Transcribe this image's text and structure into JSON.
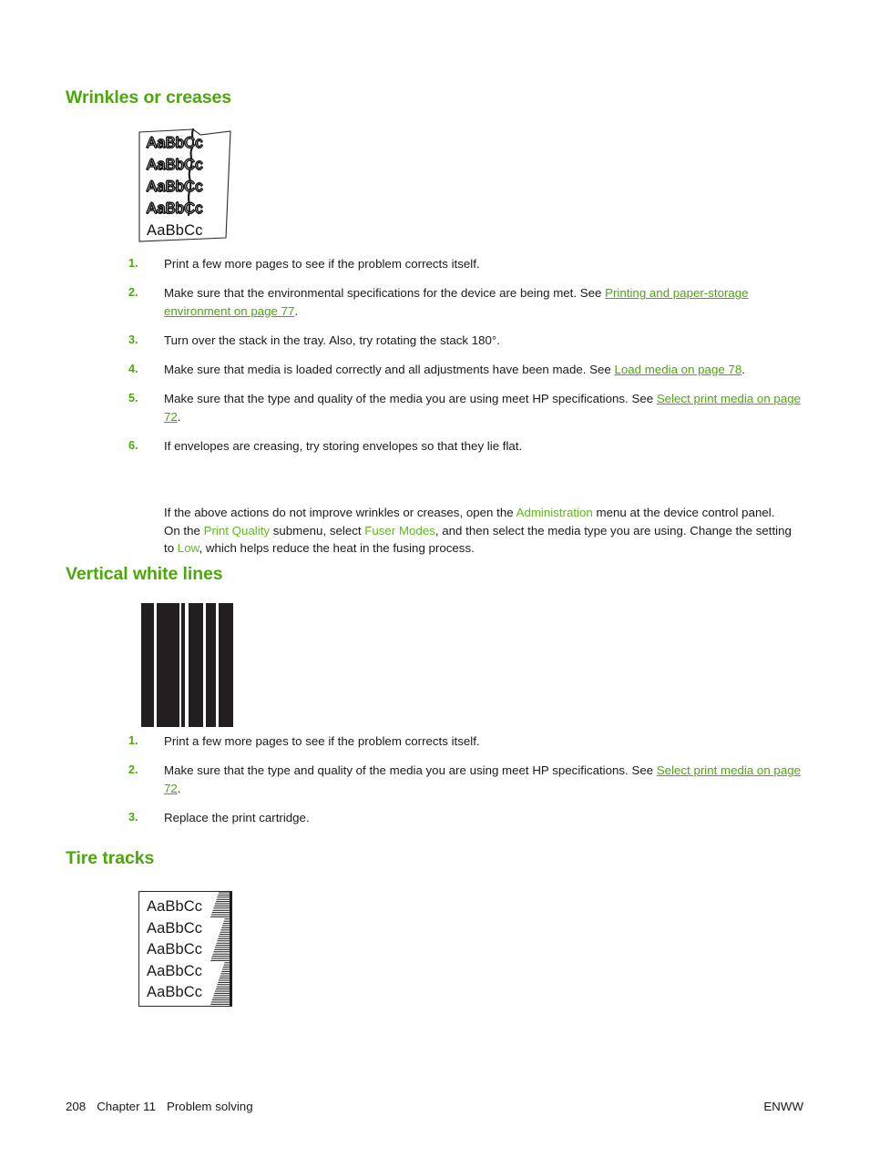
{
  "page": {
    "number": "208",
    "chapter": "Chapter 11",
    "chapter_title": "Problem solving",
    "locale_code": "ENWW",
    "accent_green": "#4CA80A",
    "term_green": "#5CBB1A",
    "text_color": "#1a1a1a"
  },
  "sections": [
    {
      "id": "wrinkles",
      "heading": "Wrinkles or creases",
      "sample": {
        "name": "wrinkles-or-creases-sample",
        "alt": "Printed page sample showing wrinkles or creases",
        "lines": [
          "AaBbCc",
          "AaBbCc",
          "AaBbCc",
          "AaBbCc",
          "AaBbCc"
        ]
      },
      "steps": [
        {
          "num": "1.",
          "parts": [
            {
              "type": "text",
              "value": "Print a few more pages to see if the problem corrects itself."
            }
          ]
        },
        {
          "num": "2.",
          "parts": [
            {
              "type": "text",
              "value": "Make sure that the environmental specifications for the device are being met. See "
            },
            {
              "type": "link",
              "value": "Printing and paper-storage environment on page 77"
            },
            {
              "type": "text",
              "value": "."
            }
          ]
        },
        {
          "num": "3.",
          "parts": [
            {
              "type": "text",
              "value": "Turn over the stack in the tray. Also, try rotating the stack 180°."
            }
          ]
        },
        {
          "num": "4.",
          "parts": [
            {
              "type": "text",
              "value": "Make sure that media is loaded correctly and all adjustments have been made. See "
            },
            {
              "type": "link",
              "value": "Load media on page 78"
            },
            {
              "type": "text",
              "value": "."
            }
          ]
        },
        {
          "num": "5.",
          "parts": [
            {
              "type": "text",
              "value": "Make sure that the type and quality of the media you are using meet HP specifications. See "
            },
            {
              "type": "link",
              "value": "Select print media on page 72"
            },
            {
              "type": "text",
              "value": "."
            }
          ]
        },
        {
          "num": "6.",
          "parts": [
            {
              "type": "text",
              "value": "If envelopes are creasing, try storing envelopes so that they lie flat."
            }
          ]
        }
      ],
      "paragraph": [
        {
          "type": "text",
          "value": "If the above actions do not improve wrinkles or creases, open the "
        },
        {
          "type": "term",
          "value": "Administration"
        },
        {
          "type": "text",
          "value": " menu at the device control panel. On the "
        },
        {
          "type": "term",
          "value": "Print Quality"
        },
        {
          "type": "text",
          "value": " submenu, select "
        },
        {
          "type": "term",
          "value": "Fuser Modes"
        },
        {
          "type": "text",
          "value": ", and then select the media type you are using. Change the setting to "
        },
        {
          "type": "term",
          "value": "Low"
        },
        {
          "type": "text",
          "value": ", which helps reduce the heat in the fusing process."
        }
      ]
    },
    {
      "id": "vertical-white-lines",
      "heading": "Vertical white lines",
      "sample": {
        "name": "vertical-white-lines-sample",
        "alt": "Solid black printed block interrupted by vertical white streaks"
      },
      "steps": [
        {
          "num": "1.",
          "parts": [
            {
              "type": "text",
              "value": "Print a few more pages to see if the problem corrects itself."
            }
          ]
        },
        {
          "num": "2.",
          "parts": [
            {
              "type": "text",
              "value": "Make sure that the type and quality of the media you are using meet HP specifications. See "
            },
            {
              "type": "link",
              "value": "Select print media on page 72"
            },
            {
              "type": "text",
              "value": "."
            }
          ]
        },
        {
          "num": "3.",
          "parts": [
            {
              "type": "text",
              "value": "Replace the print cartridge."
            }
          ]
        }
      ]
    },
    {
      "id": "tire-tracks",
      "heading": "Tire tracks",
      "sample": {
        "name": "tire-tracks-sample",
        "alt": "Printed page sample showing tire-track marks along the right edge",
        "lines": [
          "AaBbCc",
          "AaBbCc",
          "AaBbCc",
          "AaBbCc",
          "AaBbCc"
        ]
      }
    }
  ]
}
